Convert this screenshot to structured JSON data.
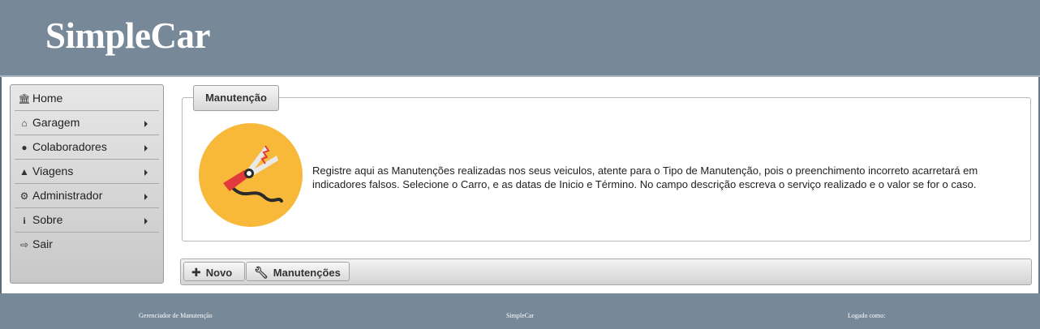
{
  "header": {
    "brand": "SimpleCar"
  },
  "sidebar": {
    "items": [
      {
        "label": "Home",
        "icon": "bank-icon",
        "has_submenu": false
      },
      {
        "label": "Garagem",
        "icon": "home-icon",
        "has_submenu": true
      },
      {
        "label": "Colaboradores",
        "icon": "users-icon",
        "has_submenu": true
      },
      {
        "label": "Viagens",
        "icon": "road-icon",
        "has_submenu": true
      },
      {
        "label": "Administrador",
        "icon": "gears-icon",
        "has_submenu": true
      },
      {
        "label": "Sobre",
        "icon": "info-icon",
        "has_submenu": true
      },
      {
        "label": "Sair",
        "icon": "sign-out-icon",
        "has_submenu": false
      }
    ]
  },
  "panel": {
    "legend": "Manutenção",
    "description": "Registre aqui as Manutenções realizadas nos seus veiculos, atente para o Tipo de Manutenção, pois o preenchimento incorreto acarretará em indicadores falsos. Selecione o Carro, e as datas de Inicio e Término. No campo descrição escreva o serviço realizado e o valor se for o caso.",
    "icon": "jumper-cable-icon"
  },
  "toolbar": {
    "novo_label": "Novo",
    "manutencoes_label": "Manutenções"
  },
  "footer": {
    "left": "Gerenciador de Manutenção",
    "center": "SimpleCar",
    "right": "Logado como:"
  },
  "colors": {
    "header_bg": "#778899",
    "icon_circle": "#f8b93a",
    "clamp_red": "#e23a3c"
  }
}
